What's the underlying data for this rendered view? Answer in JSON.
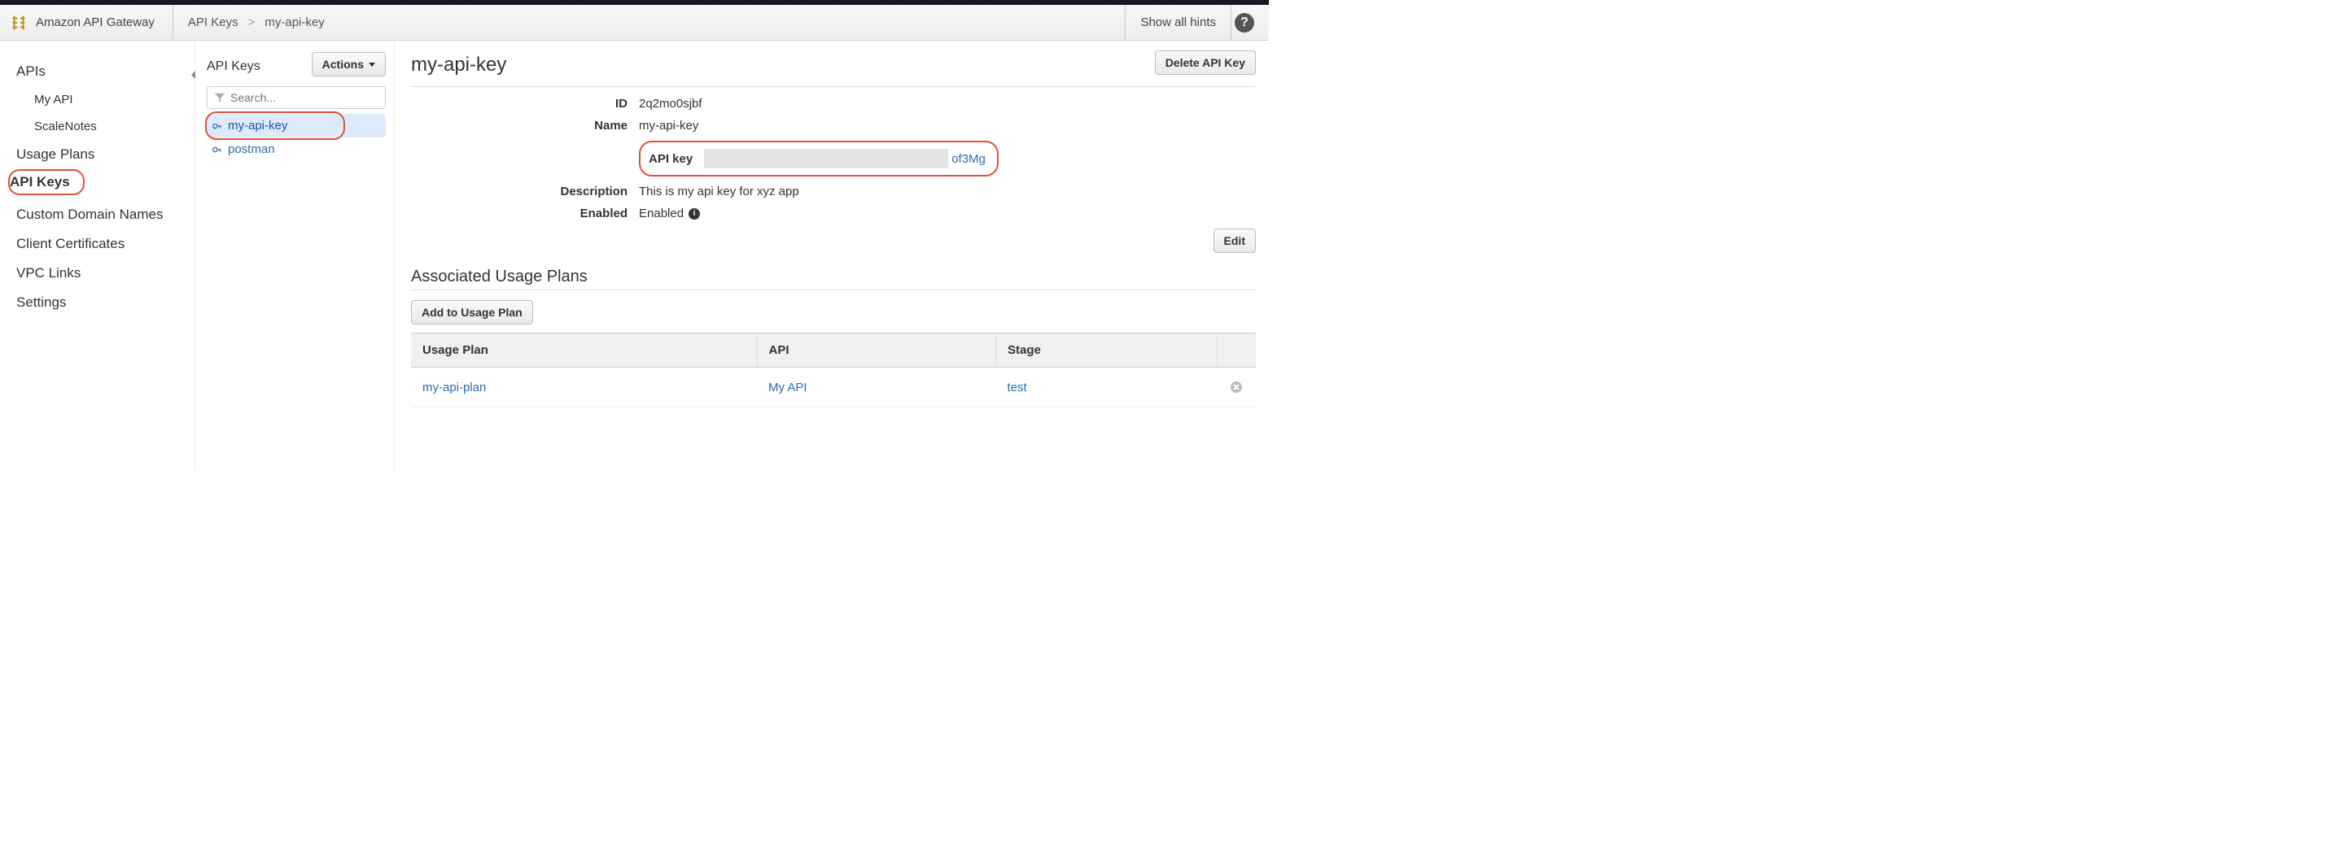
{
  "header": {
    "service_name": "Amazon API Gateway",
    "breadcrumb": {
      "root": "API Keys",
      "sep": ">",
      "current": "my-api-key"
    },
    "hints_label": "Show all hints"
  },
  "sidebar": {
    "items": [
      "APIs",
      "My API",
      "ScaleNotes",
      "Usage Plans",
      "API Keys",
      "Custom Domain Names",
      "Client Certificates",
      "VPC Links",
      "Settings"
    ]
  },
  "mid": {
    "title": "API Keys",
    "actions_label": "Actions",
    "search_placeholder": "Search...",
    "keys": [
      {
        "name": "my-api-key",
        "selected": true
      },
      {
        "name": "postman",
        "selected": false
      }
    ]
  },
  "detail": {
    "title": "my-api-key",
    "delete_label": "Delete API Key",
    "edit_label": "Edit",
    "fields": {
      "id_label": "ID",
      "id_value": "2q2mo0sjbf",
      "name_label": "Name",
      "name_value": "my-api-key",
      "apikey_label": "API key",
      "apikey_tail": "of3Mg",
      "desc_label": "Description",
      "desc_value": "This is my api key for xyz app",
      "enabled_label": "Enabled",
      "enabled_value": "Enabled"
    },
    "assoc_title": "Associated Usage Plans",
    "add_plan_label": "Add to Usage Plan",
    "table": {
      "cols": [
        "Usage Plan",
        "API",
        "Stage"
      ],
      "rows": [
        {
          "plan": "my-api-plan",
          "api": "My API",
          "stage": "test"
        }
      ]
    }
  }
}
